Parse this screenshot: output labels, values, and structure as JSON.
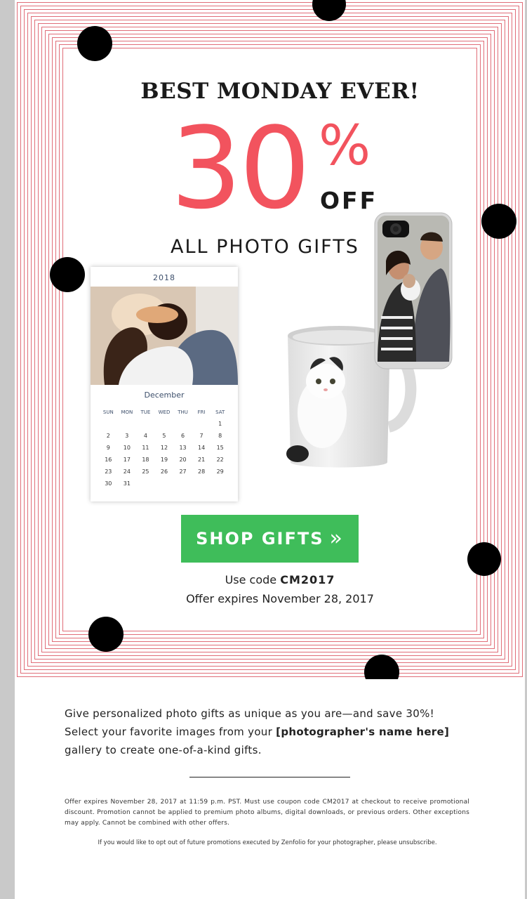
{
  "hero": {
    "headline": "BEST MONDAY EVER!",
    "discount_number": "30",
    "percent_sign": "%",
    "off_text": "OFF",
    "subhead": "ALL PHOTO GIFTS",
    "accent_color": "#f2535e",
    "frame_color": "#e06d78"
  },
  "calendar": {
    "year": "2018",
    "month": "December",
    "weekdays": [
      "SUN",
      "MON",
      "TUE",
      "WED",
      "THU",
      "FRI",
      "SAT"
    ],
    "weeks": [
      [
        "",
        "",
        "",
        "",
        "",
        "",
        "1"
      ],
      [
        "2",
        "3",
        "4",
        "5",
        "6",
        "7",
        "8"
      ],
      [
        "9",
        "10",
        "11",
        "12",
        "13",
        "14",
        "15"
      ],
      [
        "16",
        "17",
        "18",
        "19",
        "20",
        "21",
        "22"
      ],
      [
        "23",
        "24",
        "25",
        "26",
        "27",
        "28",
        "29"
      ],
      [
        "30",
        "31",
        "",
        "",
        "",
        "",
        ""
      ]
    ]
  },
  "cta": {
    "label": "SHOP GIFTS",
    "arrow": "»",
    "color": "#3fbd5a"
  },
  "offer": {
    "code_prefix": "Use code",
    "code": "CM2017",
    "expires": "Offer expires November 28, 2017"
  },
  "body": {
    "line1": "Give personalized photo gifts as unique as you are—and save 30%!",
    "line2_prefix": "Select your favorite images from your",
    "photographer_placeholder": "[photographer's name here]",
    "line3": "gallery to create one-of-a-kind gifts."
  },
  "fine_print": "Offer expires November 28, 2017 at 11:59 p.m. PST. Must use coupon code CM2017 at checkout to receive promotional discount. Promotion cannot be applied to premium photo albums, digital downloads, or previous orders. Other exceptions may apply. Cannot be combined with other offers.",
  "unsubscribe": "If you would like to opt out of future promotions executed by Zenfolio for your photographer, please unsubscribe."
}
